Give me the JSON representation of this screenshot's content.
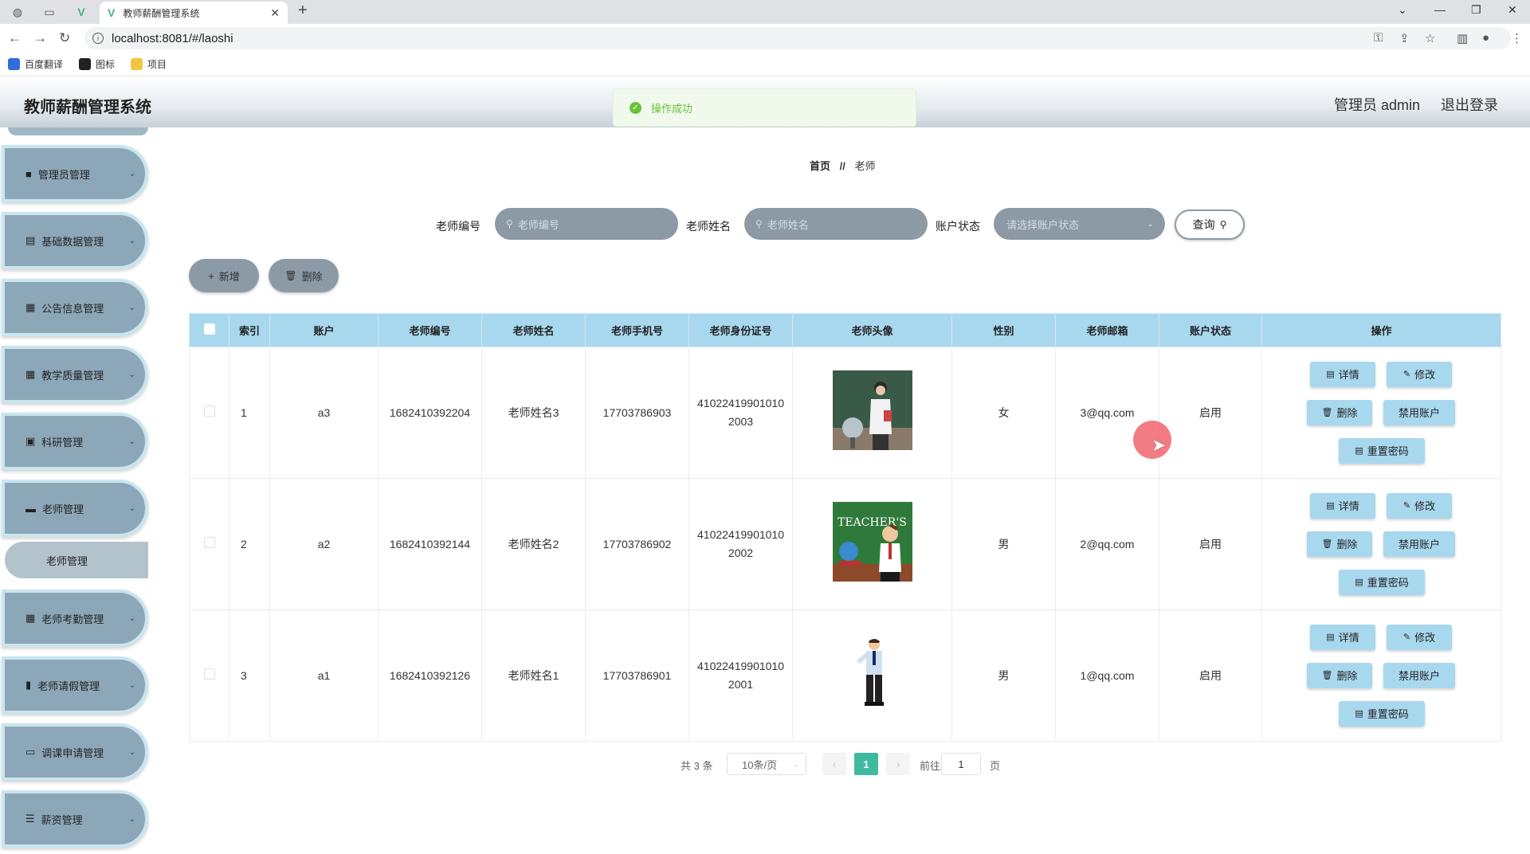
{
  "browser": {
    "tab_title": "教师薪酬管理系统",
    "url": "localhost:8081/#/laoshi",
    "bookmarks": [
      {
        "label": "百度翻译",
        "color": "#2f6ddb"
      },
      {
        "label": "图标",
        "color": "#222222"
      },
      {
        "label": "项目",
        "color": "#f4c542"
      }
    ]
  },
  "header": {
    "title": "教师薪酬管理系统",
    "admin_label": "管理员 admin",
    "logout": "退出登录"
  },
  "toast": {
    "message": "操作成功",
    "color": "#67c23a"
  },
  "sidebar": {
    "items": [
      {
        "label": "管理员管理",
        "icon": "briefcase-icon"
      },
      {
        "label": "基础数据管理",
        "icon": "clipboard-icon"
      },
      {
        "label": "公告信息管理",
        "icon": "grid-icon"
      },
      {
        "label": "教学质量管理",
        "icon": "grid-icon"
      },
      {
        "label": "科研管理",
        "icon": "document-icon"
      },
      {
        "label": "老师管理",
        "icon": "user-card-icon"
      },
      {
        "label": "老师考勤管理",
        "icon": "grid-icon"
      },
      {
        "label": "老师请假管理",
        "icon": "chart-icon"
      },
      {
        "label": "调课申请管理",
        "icon": "monitor-icon"
      },
      {
        "label": "薪资管理",
        "icon": "sliders-icon"
      }
    ],
    "submenu": {
      "label": "老师管理"
    }
  },
  "breadcrumb": {
    "home": "首页",
    "sep": "//",
    "current": "老师"
  },
  "search": {
    "teacher_no_label": "老师编号",
    "teacher_no_placeholder": "老师编号",
    "teacher_name_label": "老师姓名",
    "teacher_name_placeholder": "老师姓名",
    "status_label": "账户状态",
    "status_placeholder": "请选择账户状态",
    "query_label": "查询"
  },
  "actions": {
    "add": "新增",
    "delete": "删除"
  },
  "table": {
    "headers": [
      "索引",
      "账户",
      "老师编号",
      "老师姓名",
      "老师手机号",
      "老师身份证号",
      "老师头像",
      "性别",
      "老师邮箱",
      "账户状态",
      "操作"
    ],
    "rows": [
      {
        "index": "1",
        "account": "a3",
        "teacher_no": "1682410392204",
        "name": "老师姓名3",
        "phone": "17703786903",
        "id_card": "410224199010102003",
        "gender": "女",
        "email": "3@qq.com",
        "status": "启用"
      },
      {
        "index": "2",
        "account": "a2",
        "teacher_no": "1682410392144",
        "name": "老师姓名2",
        "phone": "17703786902",
        "id_card": "410224199010102002",
        "gender": "男",
        "email": "2@qq.com",
        "status": "启用"
      },
      {
        "index": "3",
        "account": "a1",
        "teacher_no": "1682410392126",
        "name": "老师姓名1",
        "phone": "17703786901",
        "id_card": "410224199010102001",
        "gender": "男",
        "email": "1@qq.com",
        "status": "启用"
      }
    ],
    "row_ops": {
      "detail": "详情",
      "edit": "修改",
      "delete": "删除",
      "disable": "禁用账户",
      "reset": "重置密码"
    }
  },
  "pagination": {
    "total": "共 3 条",
    "page_size": "10条/页",
    "current": "1",
    "goto": "前往",
    "goto_value": "1",
    "page_unit": "页"
  }
}
